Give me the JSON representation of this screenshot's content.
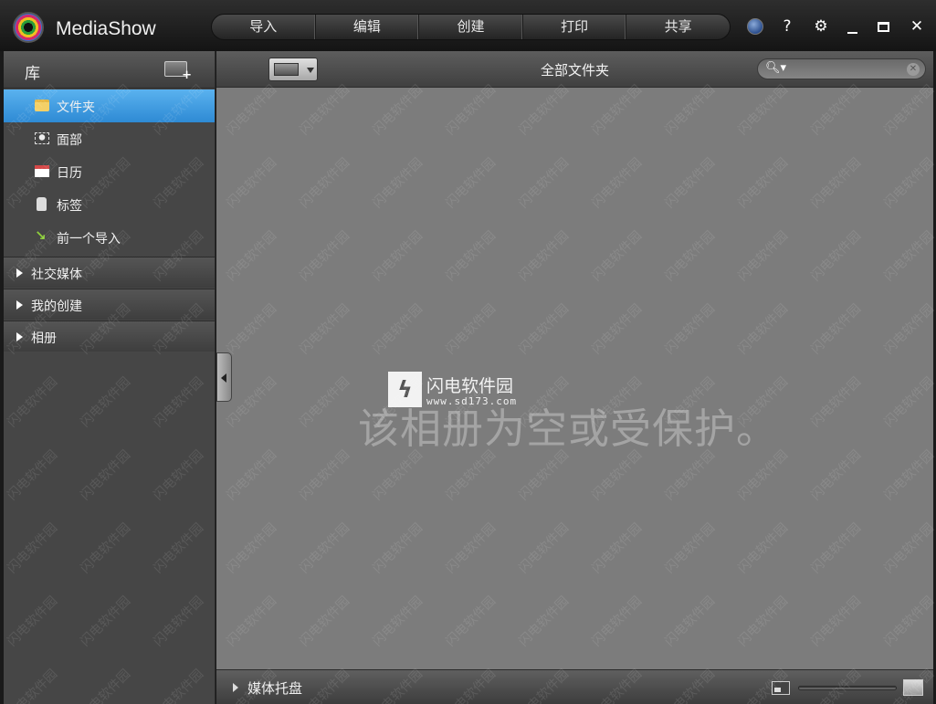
{
  "app": {
    "title": "MediaShow"
  },
  "menu": {
    "items": [
      "导入",
      "编辑",
      "创建",
      "打印",
      "共享"
    ]
  },
  "window_controls": {
    "help": "?",
    "settings": "⚙",
    "close": "✕"
  },
  "sidebar": {
    "title": "库",
    "items": [
      {
        "label": "文件夹",
        "icon": "folder-icon",
        "selected": true
      },
      {
        "label": "面部",
        "icon": "face-icon",
        "selected": false
      },
      {
        "label": "日历",
        "icon": "calendar-icon",
        "selected": false
      },
      {
        "label": "标签",
        "icon": "tag-icon",
        "selected": false
      },
      {
        "label": "前一个导入",
        "icon": "previous-import-icon",
        "selected": false
      }
    ],
    "sections": [
      "社交媒体",
      "我的创建",
      "相册"
    ]
  },
  "main": {
    "folder_title": "全部文件夹",
    "search": {
      "placeholder": "",
      "value": ""
    },
    "empty_message": "该相册为空或受保护。",
    "brand": {
      "name": "闪电软件园",
      "url": "www.sd173.com",
      "logo_glyph": "ϟ"
    },
    "tray": {
      "label": "媒体托盘"
    }
  },
  "watermark": {
    "text": "闪电软件园"
  },
  "colors": {
    "selected": "#3d9be3",
    "sidebar_bg": "#464646",
    "main_bg": "#7c7c7c",
    "calendar_red": "#d54848",
    "folder_yellow": "#f4d067",
    "import_green": "#8fd13c"
  }
}
